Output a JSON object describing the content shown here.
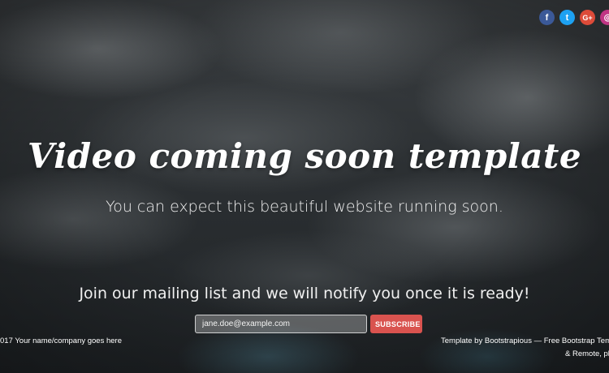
{
  "social": [
    {
      "icon": "facebook-icon",
      "glyph": "f",
      "color": "#3b5998"
    },
    {
      "icon": "twitter-icon",
      "glyph": "t",
      "color": "#1da1f2"
    },
    {
      "icon": "google-plus-icon",
      "glyph": "G+",
      "color": "#dd4b39"
    },
    {
      "icon": "instagram-icon",
      "glyph": "◎",
      "color": "#c13584"
    }
  ],
  "heading": "Video coming soon template",
  "subheading": "You can expect this beautiful website running soon.",
  "mailing": {
    "text": "Join our mailing list and we will notify you once it is ready!",
    "placeholder": "jane.doe@example.com",
    "button_label": "SUBSCRIBE",
    "button_color": "#d9534f"
  },
  "footer": {
    "left": "017 Your name/company goes here",
    "right_line1": "Template by Bootstrapious — Free Bootstrap Templa",
    "right_line2": "& Remote, ple"
  }
}
